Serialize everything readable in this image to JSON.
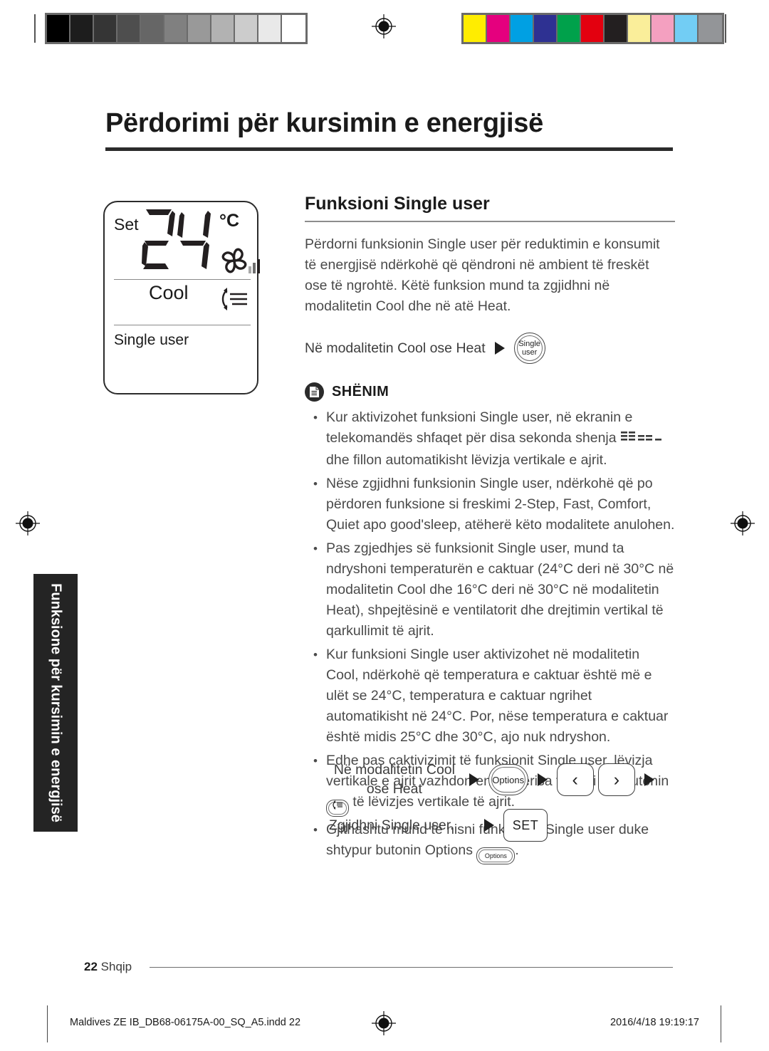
{
  "page": {
    "title": "Përdorimi për kursimin e energjisë",
    "side_tab": "Funksione për kursimin e energjisë",
    "folio_number": "22",
    "folio_language": "Shqip",
    "slug_left": "Maldives ZE IB_DB68-06175A-00_SQ_A5.indd   22",
    "slug_right": "2016/4/18   19:19:17"
  },
  "calibration": {
    "grayscale": [
      "#000000",
      "#1d1d1d",
      "#353535",
      "#4e4e4e",
      "#666666",
      "#808080",
      "#999999",
      "#b2b2b2",
      "#cccccc",
      "#e9e9e9",
      "#ffffff"
    ],
    "colors": [
      "#ffed00",
      "#e5007e",
      "#00a0e3",
      "#2e3192",
      "#00a14b",
      "#e3000f",
      "#231f20",
      "#faee9a",
      "#f4a0c0",
      "#72cdf4",
      "#939598"
    ]
  },
  "display": {
    "set_label": "Set",
    "temperature": "24",
    "unit": "°C",
    "mode": "Cool",
    "sub_label": "Single user",
    "fan_bars": 3
  },
  "section": {
    "heading": "Funksioni Single user",
    "intro": "Përdorni funksionin Single user për reduktimin e konsumit të energjisë ndërkohë që qëndroni në ambient të freskët ose të ngrohtë. Këtë funksion mund ta zgjidhni në modalitetin Cool dhe në atë Heat.",
    "flow": {
      "text": "Në modalitetin Cool ose Heat",
      "button_line1": "Single",
      "button_line2": "user"
    }
  },
  "note": {
    "title": "SHËNIM",
    "items": [
      {
        "before": "Kur aktivizohet funksioni Single user, në ekranin e telekomandës shfaqet për disa sekonda shenja ",
        "glyph": "lcd-segments",
        "after": " dhe fillon automatikisht lëvizja vertikale e ajrit."
      },
      {
        "before": "Nëse zgjidhni funksionin Single user, ndërkohë që po përdoren funksione si freskimi 2-Step, Fast, Comfort, Quiet apo good'sleep, atëherë këto modalitete anulohen."
      },
      {
        "before": "Pas zgjedhjes së funksionit Single user, mund ta ndryshoni temperaturën e caktuar (24°C deri në 30°C në modalitetin Cool dhe 16°C deri në 30°C në modalitetin Heat), shpejtësinë e ventilatorit dhe drejtimin vertikal të qarkullimit të ajrit."
      },
      {
        "before": "Kur funksioni Single user aktivizohet në modalitetin Cool, ndërkohë që temperatura e caktuar është më e ulët se 24°C, temperatura e caktuar ngrihet automatikisht në 24°C. Por, nëse temperatura e caktuar është midis 25°C dhe 30°C, ajo nuk ndryshon."
      },
      {
        "before": "Edhe pas çaktivizimit të funksionit Single user, lëvizja vertikale e ajrit vazhdon ende, derisa ta fikni me butonin ",
        "glyph": "swing-button",
        "after": " të lëvizjes vertikale të ajrit."
      },
      {
        "before": "Gjithashtu mund të nisni funksionin Single user duke shtypur butonin Options ",
        "glyph": "options-button",
        "glyph_label": "Options",
        "after": "."
      }
    ]
  },
  "procedure": {
    "row1": {
      "label": "Në modalitetin Cool ose Heat",
      "options_button": "Options",
      "left_arrow": "‹",
      "right_arrow": "›"
    },
    "row2": {
      "label": "Zgjidhni Single user.",
      "set_button": "SET"
    }
  }
}
